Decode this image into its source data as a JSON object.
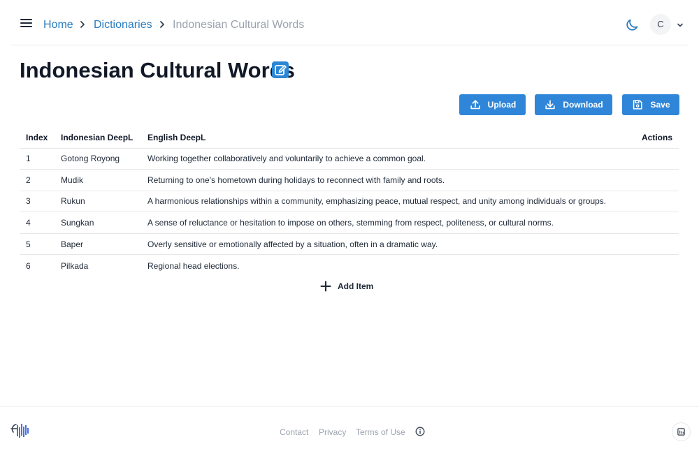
{
  "header": {
    "breadcrumbs": [
      {
        "label": "Home"
      },
      {
        "label": "Dictionaries"
      },
      {
        "label": "Indonesian Cultural Words"
      }
    ],
    "avatar_initial": "C",
    "icons": [
      "menu-icon",
      "chevron-right-icon",
      "moon-icon",
      "chevron-down-icon"
    ]
  },
  "page": {
    "title": "Indonesian Cultural Words",
    "edit_icon": "edit-icon"
  },
  "toolbar": {
    "upload_label": "Upload",
    "download_label": "Download",
    "save_label": "Save"
  },
  "table": {
    "columns": [
      "Index",
      "Indonesian DeepL",
      "English DeepL",
      "Actions"
    ],
    "rows": [
      {
        "index": "1",
        "indonesian": "Gotong Royong",
        "english": "Working together collaboratively and voluntarily to achieve a common goal."
      },
      {
        "index": "2",
        "indonesian": "Mudik",
        "english": "Returning to one's hometown during holidays to reconnect with family and roots."
      },
      {
        "index": "3",
        "indonesian": "Rukun",
        "english": "A harmonious relationships within a community, emphasizing peace, mutual respect, and unity among individuals or groups."
      },
      {
        "index": "4",
        "indonesian": "Sungkan",
        "english": "A sense of reluctance or hesitation to impose on others, stemming from respect, politeness, or cultural norms."
      },
      {
        "index": "5",
        "indonesian": "Baper",
        "english": "Overly sensitive or emotionally affected by a situation, often in a dramatic way."
      },
      {
        "index": "6",
        "indonesian": "Pilkada",
        "english": "Regional head elections."
      }
    ],
    "add_item_label": "Add Item"
  },
  "footer": {
    "links": [
      "Contact",
      "Privacy",
      "Terms of Use"
    ]
  },
  "colors": {
    "accent": "#2f86d8",
    "link": "#2b7dbf",
    "muted": "#9ca3af"
  }
}
